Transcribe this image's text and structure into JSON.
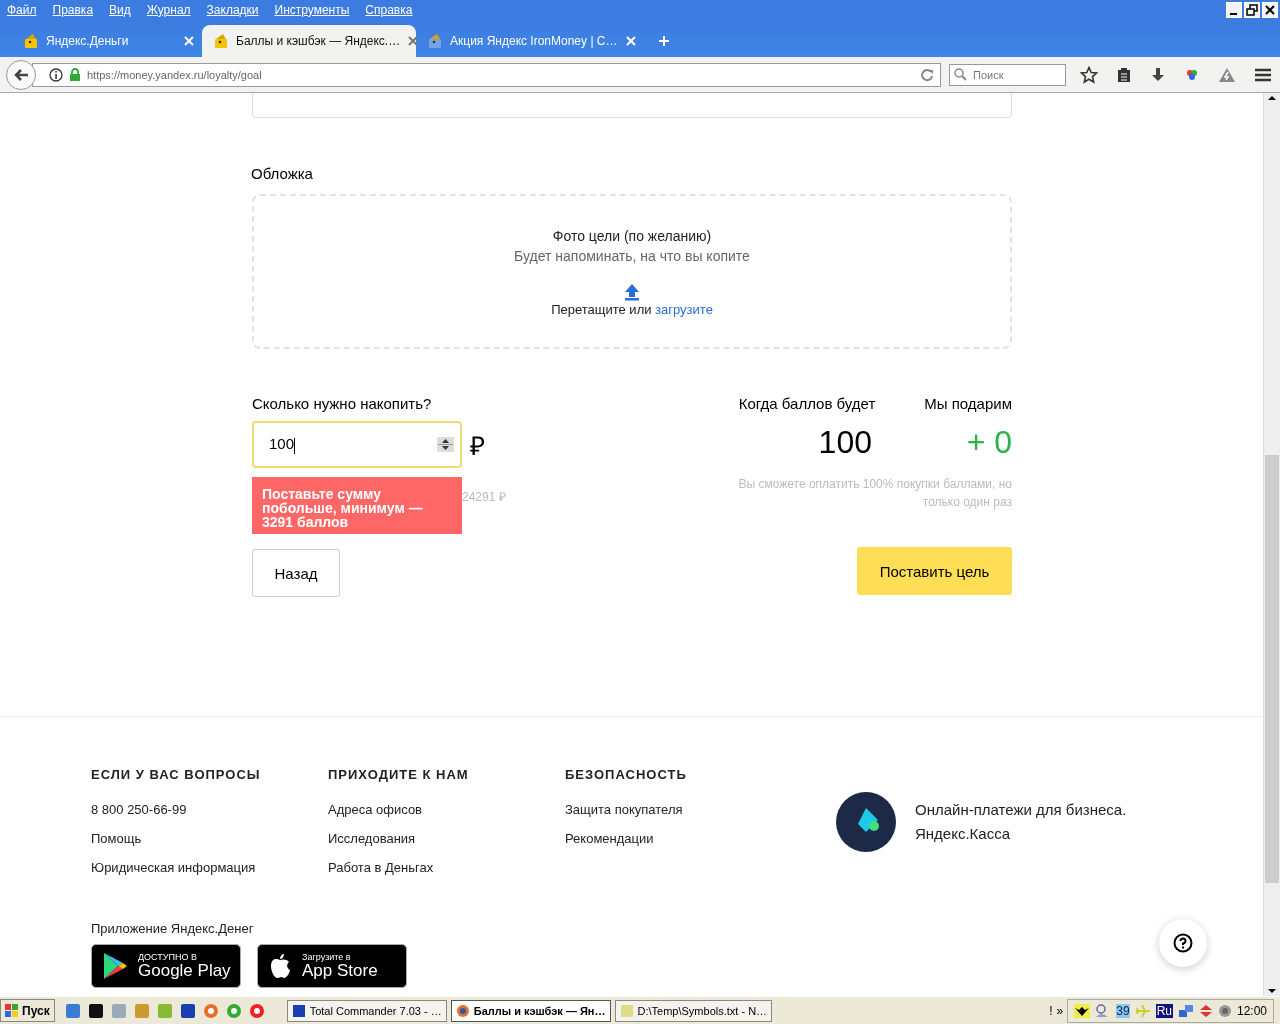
{
  "menu": [
    "Файл",
    "Правка",
    "Вид",
    "Журнал",
    "Закладки",
    "Инструменты",
    "Справка"
  ],
  "tabs": [
    {
      "title": "Яндекс.Деньги",
      "selected": false
    },
    {
      "title": "Баллы и кэшбэк — Яндекс.…",
      "selected": true
    },
    {
      "title": "Акция Яндекс IronMoney | С…",
      "selected": false
    }
  ],
  "address": {
    "url": "https://money.yandex.ru/loyalty/goal"
  },
  "search": {
    "placeholder": "Поиск"
  },
  "cover": {
    "label": "Обложка",
    "title": "Фото цели (по желанию)",
    "subtitle": "Будет напоминать, на что вы копите",
    "drop_text": "Перетащите или",
    "upload_link": "загрузите"
  },
  "amount": {
    "label": "Сколько нужно накопить?",
    "value": "100",
    "currency": "₽",
    "hint": "24291 ₽",
    "error": "Поставьте сумму побольше, минимум — 3291 баллов"
  },
  "summary": {
    "points_label": "Когда баллов будет",
    "points_value": "100",
    "gift_label": "Мы подарим",
    "gift_value": "+ 0",
    "note": "Вы сможете оплатить 100% покупки баллами, но только один раз"
  },
  "buttons": {
    "back": "Назад",
    "submit": "Поставить цель"
  },
  "footer": {
    "columns": [
      {
        "heading": "ЕСЛИ У ВАС ВОПРОСЫ",
        "links": [
          "8 800 250-66-99",
          "Помощь",
          "Юридическая информация"
        ]
      },
      {
        "heading": "ПРИХОДИТЕ К НАМ",
        "links": [
          "Адреса офисов",
          "Исследования",
          "Работа в Деньгах"
        ]
      },
      {
        "heading": "БЕЗОПАСНОСТЬ",
        "links": [
          "Защита покупателя",
          "Рекомендации"
        ]
      }
    ],
    "kassa": [
      "Онлайн-платежи для бизнеса.",
      "Яндекс.Касса"
    ],
    "app_label": "Приложение Яндекс.Денег",
    "badges": [
      {
        "kind": "google",
        "small": "ДОСТУПНО В",
        "big": "Google Play"
      },
      {
        "kind": "apple",
        "small": "Загрузите в",
        "big": "App Store"
      }
    ]
  },
  "taskbar": {
    "start": "Пуск",
    "windows": [
      {
        "title": "Total Commander 7.03 - …",
        "selected": false
      },
      {
        "title": "Баллы и кэшбэк — Ян…",
        "selected": true
      },
      {
        "title": "D:\\Temp\\Symbols.txt - N…",
        "selected": false
      }
    ],
    "tray": [
      "!",
      "»",
      "39",
      "Ru"
    ],
    "clock": "12:00"
  }
}
